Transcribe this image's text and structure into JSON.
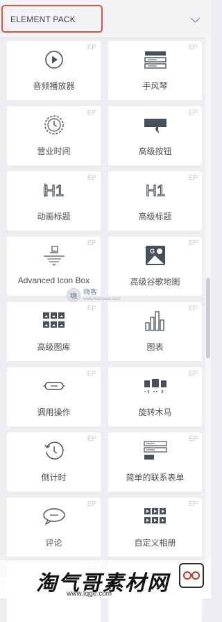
{
  "header": {
    "title": "ELEMENT PACK"
  },
  "badge": "EP",
  "tiles": [
    {
      "label": "音频播放器",
      "icon": "audio-player-icon"
    },
    {
      "label": "手风琴",
      "icon": "accordion-icon"
    },
    {
      "label": "营业时间",
      "icon": "business-hours-icon"
    },
    {
      "label": "高级按钮",
      "icon": "advanced-button-icon"
    },
    {
      "label": "动画标题",
      "icon": "animated-heading-icon"
    },
    {
      "label": "高级标题",
      "icon": "advanced-heading-icon"
    },
    {
      "label": "Advanced Icon Box",
      "icon": "advanced-icon-box-icon"
    },
    {
      "label": "高级谷歌地图",
      "icon": "advanced-google-map-icon"
    },
    {
      "label": "高级图库",
      "icon": "advanced-gallery-icon"
    },
    {
      "label": "图表",
      "icon": "chart-icon"
    },
    {
      "label": "调用操作",
      "icon": "call-to-action-icon"
    },
    {
      "label": "旋转木马",
      "icon": "carousel-icon"
    },
    {
      "label": "倒计时",
      "icon": "countdown-icon"
    },
    {
      "label": "简单的联系表单",
      "icon": "contact-form-icon"
    },
    {
      "label": "评论",
      "icon": "comment-icon"
    },
    {
      "label": "自定义相册",
      "icon": "custom-gallery-icon"
    }
  ],
  "watermarks": {
    "center_badge": "嗨",
    "center_text": "嗨客",
    "center_sub": "www.miaoyuan.com",
    "bottom_title": "淘气哥素材网",
    "bottom_sub": "www.tqge.com"
  }
}
